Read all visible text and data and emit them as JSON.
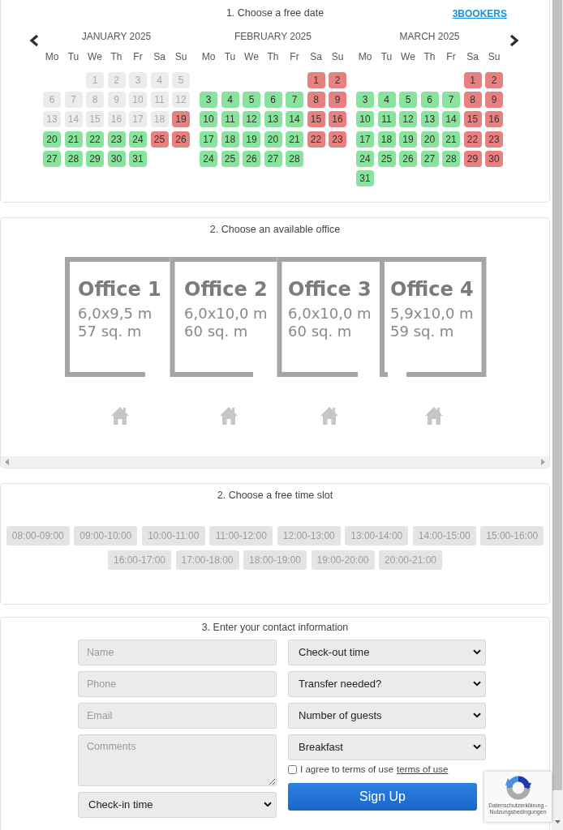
{
  "date_section": {
    "title": "1. Choose a free date",
    "brand_link": "3BOOKERS",
    "months": [
      {
        "title": "JANUARY 2025",
        "weekdays": [
          "Mo",
          "Tu",
          "We",
          "Th",
          "Fr",
          "Sa",
          "Su"
        ],
        "weeks": [
          [
            {
              "day": "1",
              "kind": "past"
            },
            {
              "day": "2",
              "kind": "past"
            },
            {
              "day": "3",
              "kind": "past"
            },
            {
              "day": "4",
              "kind": "past"
            },
            {
              "day": "5",
              "kind": "past"
            }
          ],
          [
            {
              "day": "6",
              "kind": "past"
            },
            {
              "day": "7",
              "kind": "past"
            },
            {
              "day": "8",
              "kind": "past"
            },
            {
              "day": "9",
              "kind": "past"
            },
            {
              "day": "10",
              "kind": "past"
            },
            {
              "day": "11",
              "kind": "past"
            },
            {
              "day": "12",
              "kind": "past"
            }
          ],
          [
            {
              "day": "13",
              "kind": "past"
            },
            {
              "day": "14",
              "kind": "past"
            },
            {
              "day": "15",
              "kind": "past"
            },
            {
              "day": "16",
              "kind": "past"
            },
            {
              "day": "17",
              "kind": "past"
            },
            {
              "day": "18",
              "kind": "past"
            },
            {
              "day": "19",
              "kind": "booked"
            }
          ],
          [
            {
              "day": "20",
              "kind": "free"
            },
            {
              "day": "21",
              "kind": "free"
            },
            {
              "day": "22",
              "kind": "free"
            },
            {
              "day": "23",
              "kind": "free"
            },
            {
              "day": "24",
              "kind": "free"
            },
            {
              "day": "25",
              "kind": "booked"
            },
            {
              "day": "26",
              "kind": "booked"
            }
          ],
          [
            {
              "day": "27",
              "kind": "free"
            },
            {
              "day": "28",
              "kind": "free"
            },
            {
              "day": "29",
              "kind": "free"
            },
            {
              "day": "30",
              "kind": "free"
            },
            {
              "day": "31",
              "kind": "free"
            }
          ]
        ]
      },
      {
        "title": "FEBRUARY 2025",
        "weekdays": [
          "Mo",
          "Tu",
          "We",
          "Th",
          "Fr",
          "Sa",
          "Su"
        ],
        "weeks": [
          [
            {
              "day": "1",
              "kind": "booked"
            },
            {
              "day": "2",
              "kind": "booked"
            }
          ],
          [
            {
              "day": "3",
              "kind": "free"
            },
            {
              "day": "4",
              "kind": "free"
            },
            {
              "day": "5",
              "kind": "free"
            },
            {
              "day": "6",
              "kind": "free"
            },
            {
              "day": "7",
              "kind": "free"
            },
            {
              "day": "8",
              "kind": "booked"
            },
            {
              "day": "9",
              "kind": "booked"
            }
          ],
          [
            {
              "day": "10",
              "kind": "free"
            },
            {
              "day": "11",
              "kind": "free"
            },
            {
              "day": "12",
              "kind": "free"
            },
            {
              "day": "13",
              "kind": "free"
            },
            {
              "day": "14",
              "kind": "free"
            },
            {
              "day": "15",
              "kind": "booked"
            },
            {
              "day": "16",
              "kind": "booked"
            }
          ],
          [
            {
              "day": "17",
              "kind": "free"
            },
            {
              "day": "18",
              "kind": "free"
            },
            {
              "day": "19",
              "kind": "free"
            },
            {
              "day": "20",
              "kind": "free"
            },
            {
              "day": "21",
              "kind": "free"
            },
            {
              "day": "22",
              "kind": "booked"
            },
            {
              "day": "23",
              "kind": "booked"
            }
          ],
          [
            {
              "day": "24",
              "kind": "free"
            },
            {
              "day": "25",
              "kind": "free"
            },
            {
              "day": "26",
              "kind": "free"
            },
            {
              "day": "27",
              "kind": "free"
            },
            {
              "day": "28",
              "kind": "free"
            }
          ]
        ]
      },
      {
        "title": "MARCH 2025",
        "weekdays": [
          "Mo",
          "Tu",
          "We",
          "Th",
          "Fr",
          "Sa",
          "Su"
        ],
        "weeks": [
          [
            {
              "day": "1",
              "kind": "booked"
            },
            {
              "day": "2",
              "kind": "booked"
            }
          ],
          [
            {
              "day": "3",
              "kind": "free"
            },
            {
              "day": "4",
              "kind": "free"
            },
            {
              "day": "5",
              "kind": "free"
            },
            {
              "day": "6",
              "kind": "free"
            },
            {
              "day": "7",
              "kind": "free"
            },
            {
              "day": "8",
              "kind": "booked"
            },
            {
              "day": "9",
              "kind": "booked"
            }
          ],
          [
            {
              "day": "10",
              "kind": "free"
            },
            {
              "day": "11",
              "kind": "free"
            },
            {
              "day": "12",
              "kind": "free"
            },
            {
              "day": "13",
              "kind": "free"
            },
            {
              "day": "14",
              "kind": "free"
            },
            {
              "day": "15",
              "kind": "booked"
            },
            {
              "day": "16",
              "kind": "booked"
            }
          ],
          [
            {
              "day": "17",
              "kind": "free"
            },
            {
              "day": "18",
              "kind": "free"
            },
            {
              "day": "19",
              "kind": "free"
            },
            {
              "day": "20",
              "kind": "free"
            },
            {
              "day": "21",
              "kind": "free"
            },
            {
              "day": "22",
              "kind": "booked"
            },
            {
              "day": "23",
              "kind": "booked"
            }
          ],
          [
            {
              "day": "24",
              "kind": "free"
            },
            {
              "day": "25",
              "kind": "free"
            },
            {
              "day": "26",
              "kind": "free"
            },
            {
              "day": "27",
              "kind": "free"
            },
            {
              "day": "28",
              "kind": "free"
            },
            {
              "day": "29",
              "kind": "booked"
            },
            {
              "day": "30",
              "kind": "booked"
            }
          ],
          [
            {
              "day": "31",
              "kind": "free"
            }
          ]
        ]
      }
    ]
  },
  "office_section": {
    "title": "2. Choose an available office",
    "offices": [
      {
        "name": "Office 1",
        "size": "6,0x9,5 m",
        "area": "57 sq. m"
      },
      {
        "name": "Office 2",
        "size": "6,0x10,0 m",
        "area": "60 sq. m"
      },
      {
        "name": "Office 3",
        "size": "6,0x10,0 m",
        "area": "60 sq. m"
      },
      {
        "name": "Office 4",
        "size": "5,9x10,0 m",
        "area": "59 sq. m"
      }
    ]
  },
  "time_section": {
    "title": "2. Choose a free time slot",
    "slots": [
      {
        "label": "08:00-09:00",
        "disabled": true
      },
      {
        "label": "09:00-10:00",
        "disabled": true
      },
      {
        "label": "10:00-11:00",
        "disabled": true
      },
      {
        "label": "11:00-12:00",
        "disabled": true
      },
      {
        "label": "12:00-13:00",
        "disabled": true
      },
      {
        "label": "13:00-14:00",
        "disabled": true
      },
      {
        "label": "14:00-15:00",
        "disabled": true
      },
      {
        "label": "15:00-16:00",
        "disabled": true
      },
      {
        "label": "16:00-17:00",
        "disabled": true
      },
      {
        "label": "17:00-18:00",
        "disabled": true
      },
      {
        "label": "18:00-19:00",
        "disabled": true
      },
      {
        "label": "19:00-20:00",
        "disabled": true
      },
      {
        "label": "20:00-21:00",
        "disabled": true
      }
    ]
  },
  "contact_section": {
    "title": "3. Enter your contact information",
    "left_fields": [
      {
        "kind": "input",
        "placeholder": "Name"
      },
      {
        "kind": "input",
        "placeholder": "Phone"
      },
      {
        "kind": "input",
        "placeholder": "Email"
      },
      {
        "kind": "textarea",
        "placeholder": "Comments"
      },
      {
        "kind": "select",
        "value": "Check-in time"
      }
    ],
    "right_fields": [
      {
        "kind": "select",
        "value": "Check-out time"
      },
      {
        "kind": "select",
        "value": "Transfer needed?"
      },
      {
        "kind": "select",
        "value": "Number of guests"
      },
      {
        "kind": "select",
        "value": "Breakfast"
      }
    ],
    "agreement": {
      "checked": false,
      "label": "I agree to terms of use",
      "link": "terms of use"
    },
    "submit": "Sign Up"
  },
  "recaptcha": {
    "links": "Datenschutzerklärung - Nutzungsbedingungen"
  }
}
